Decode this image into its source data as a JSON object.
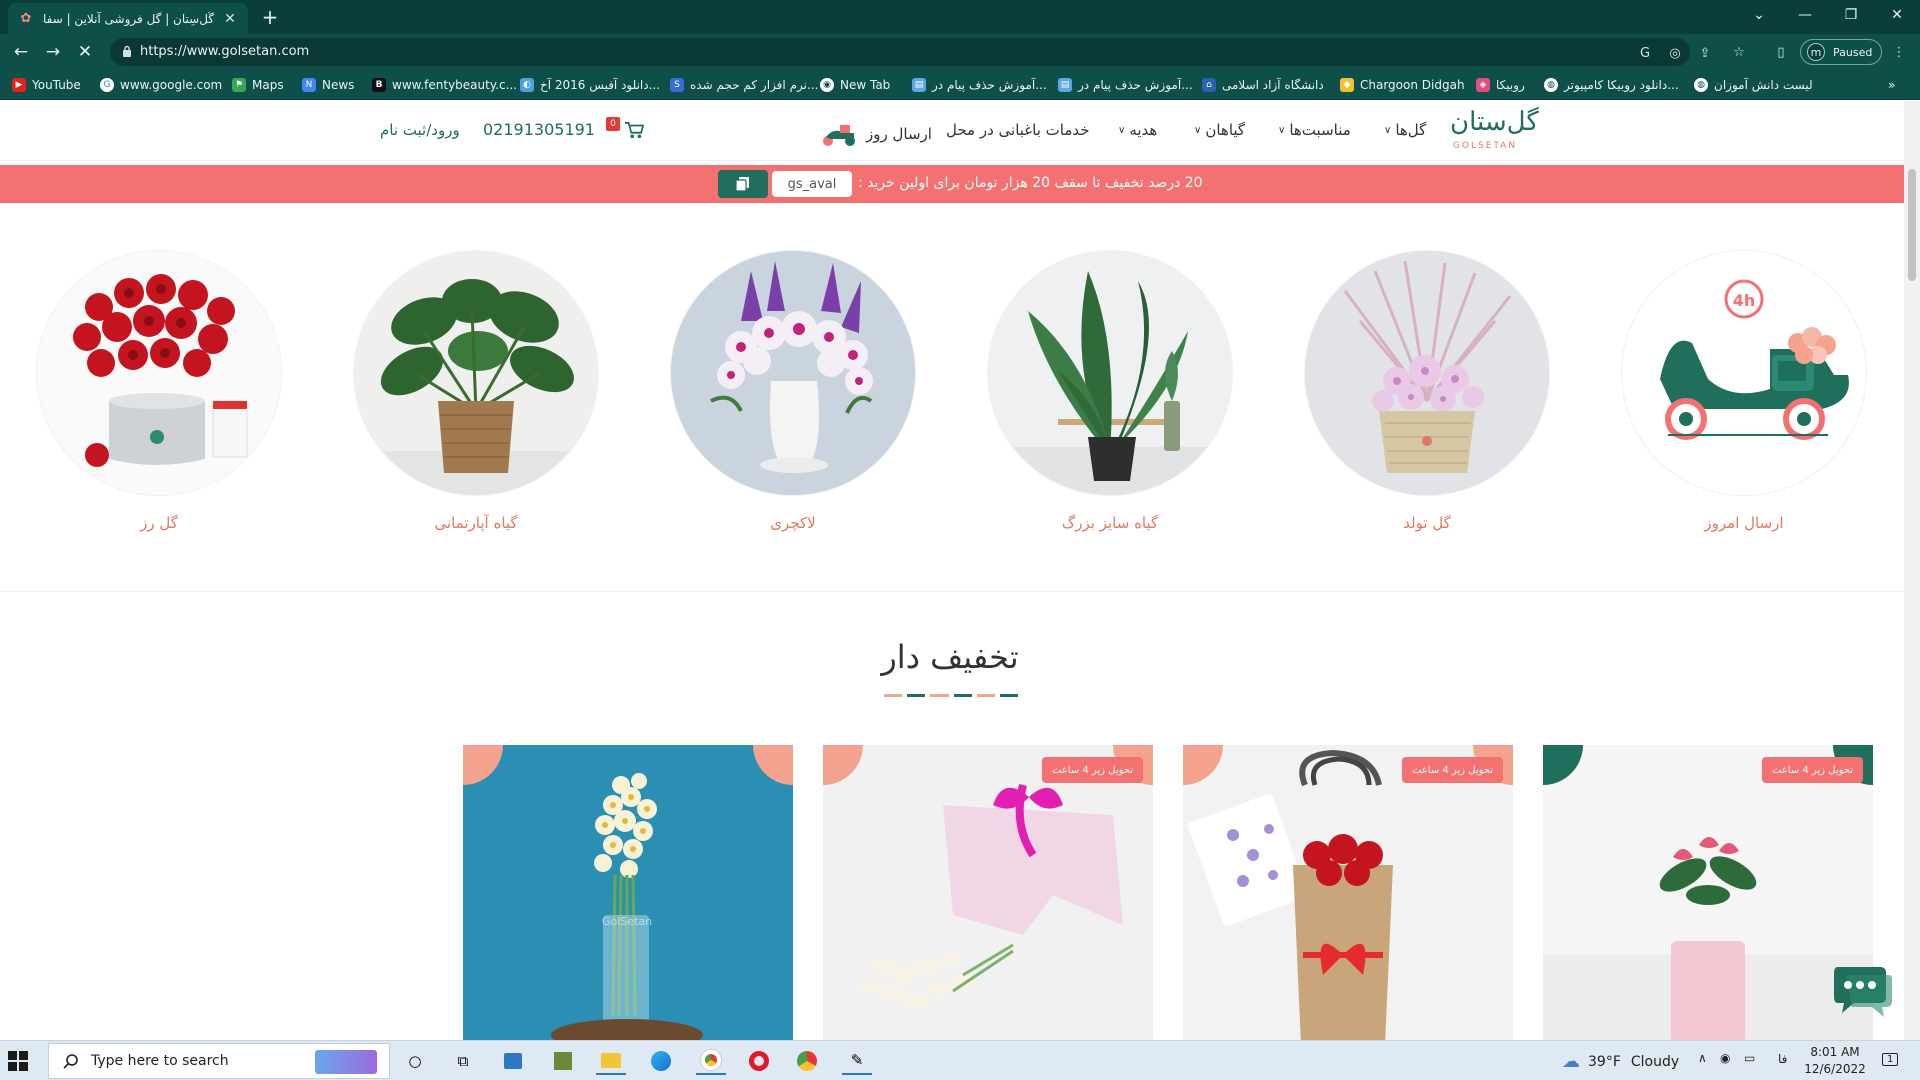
{
  "browser": {
    "tab_title": "گُل‌سِتان | گل فروشی آنلاین | سفارش",
    "url": "https://www.golsetan.com",
    "profile_initial": "m",
    "profile_status": "Paused",
    "bookmarks": [
      {
        "label": "YouTube",
        "icon": "youtube-icon",
        "color": "#e62117"
      },
      {
        "label": "www.google.com",
        "icon": "google-icon",
        "color": "#ffffff"
      },
      {
        "label": "Maps",
        "icon": "maps-icon",
        "color": "#34a853"
      },
      {
        "label": "News",
        "icon": "news-icon",
        "color": "#4285f4"
      },
      {
        "label": "www.fentybeauty.c...",
        "icon": "fenty-icon",
        "color": "#111111"
      },
      {
        "label": "دانلود آفیس 2016 آخ...",
        "icon": "office-icon",
        "color": "#4aa3df"
      },
      {
        "label": "نرم افزار کم حجم شده...",
        "icon": "app-icon",
        "color": "#3a6bd6"
      },
      {
        "label": "New Tab",
        "icon": "chrome-icon",
        "color": "#ffffff"
      },
      {
        "label": "آموزش حذف پیام در...",
        "icon": "doc-icon",
        "color": "#5aa9e6"
      },
      {
        "label": "آموزش حذف پیام در...",
        "icon": "doc-icon",
        "color": "#5aa9e6"
      },
      {
        "label": "دانشگاه آزاد اسلامی",
        "icon": "university-icon",
        "color": "#2f5fb3"
      },
      {
        "label": "Chargoon Didgah",
        "icon": "didgah-icon",
        "color": "#f2c230"
      },
      {
        "label": "روبیکا",
        "icon": "rubika-icon",
        "color": "#e04e7d"
      },
      {
        "label": "دانلود روبیکا کامپیوتر...",
        "icon": "globe-icon",
        "color": "#ffffff"
      },
      {
        "label": "لیست دانش آموزان",
        "icon": "globe-icon",
        "color": "#ffffff"
      }
    ]
  },
  "site": {
    "logo_text": "GOLSETAN",
    "logo_mark": "گل‌ستان",
    "menu": [
      {
        "label": "گل‌ها",
        "has_dropdown": true
      },
      {
        "label": "مناسبت‌ها",
        "has_dropdown": true
      },
      {
        "label": "گیاهان",
        "has_dropdown": true
      },
      {
        "label": "هدیه",
        "has_dropdown": true
      },
      {
        "label": "خدمات باغبانی در محل",
        "has_dropdown": false
      },
      {
        "label": "ارسال روز",
        "has_dropdown": false
      }
    ],
    "cart_count": "0",
    "phone": "02191305191",
    "login": "ورود/ثبت نام",
    "promo": {
      "text": "20 درصد تخفیف تا سقف 20 هزار تومان برای اولین خرید :",
      "coupon": "gs_aval"
    },
    "categories": [
      {
        "label": "ارسال امروز"
      },
      {
        "label": "گل تولد"
      },
      {
        "label": "گیاه سایز بزرگ"
      },
      {
        "label": "لاکچری"
      },
      {
        "label": "گیاه آپارتمانی"
      },
      {
        "label": "گل رز"
      }
    ],
    "delivery_badge_text": "4h",
    "section_title": "تخفیف دار",
    "products": [
      {
        "tag": "تحویل زیر 4 ساعت",
        "accent": "#1f6f5c"
      },
      {
        "tag": "تحویل زیر 4 ساعت",
        "accent": "#f4a38f"
      },
      {
        "tag": "تحویل زیر 4 ساعت",
        "accent": "#f4a38f"
      },
      {
        "tag": "",
        "accent": "#f4a38f"
      }
    ],
    "watermark": "GolSetan"
  },
  "colors": {
    "brand_green": "#1f6f5c",
    "brand_coral": "#f47171",
    "browser_frame": "#0e4f49"
  },
  "taskbar": {
    "search_placeholder": "Type here to search",
    "weather_temp": "39°F",
    "weather_text": "Cloudy",
    "language": "فا",
    "time": "8:01 AM",
    "date": "12/6/2022",
    "notification_count": "1"
  }
}
